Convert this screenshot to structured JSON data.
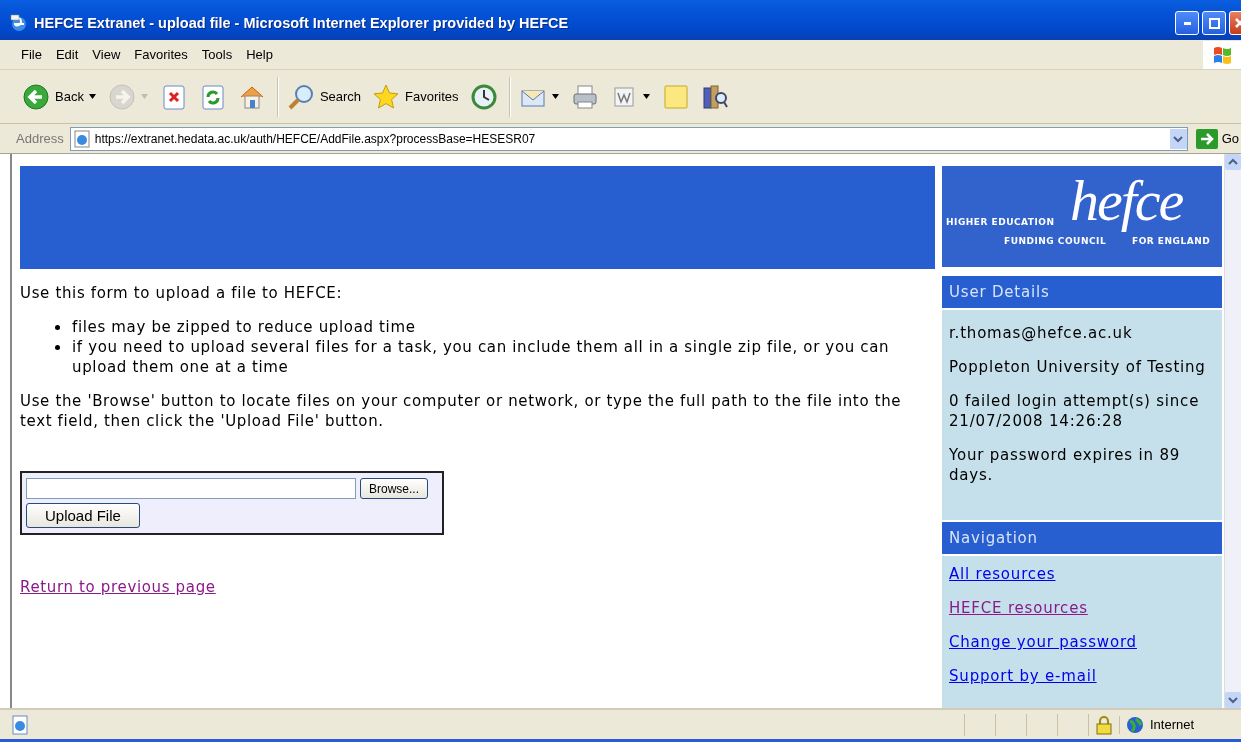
{
  "window": {
    "title": "HEFCE Extranet - upload file - Microsoft Internet Explorer provided by HEFCE"
  },
  "menu": [
    "File",
    "Edit",
    "View",
    "Favorites",
    "Tools",
    "Help"
  ],
  "toolbar": [
    {
      "kind": "back",
      "label": "Back",
      "disabled": false
    },
    {
      "kind": "forward",
      "disabled": true
    },
    {
      "kind": "stop",
      "disabled": false
    },
    {
      "kind": "refresh",
      "disabled": false
    },
    {
      "kind": "home",
      "disabled": false
    },
    {
      "kind": "search",
      "label": "Search",
      "disabled": false
    },
    {
      "kind": "favorites",
      "label": "Favorites",
      "disabled": false
    },
    {
      "kind": "history",
      "disabled": false
    },
    {
      "kind": "mail",
      "disabled": false
    },
    {
      "kind": "print",
      "disabled": false
    },
    {
      "kind": "word",
      "disabled": false
    },
    {
      "kind": "note",
      "disabled": false
    },
    {
      "kind": "research",
      "disabled": false
    }
  ],
  "address": {
    "label": "Address",
    "url": "https://extranet.hedata.ac.uk/auth/HEFCE/AddFile.aspx?processBase=HESESR07",
    "go": "Go"
  },
  "logo": {
    "wordmark": "hefce",
    "line_1": "HIGHER EDUCATION",
    "line_2": "FUNDING COUNCIL",
    "line_3": "FOR ENGLAND"
  },
  "main": {
    "intro": "Use this form to upload a file to HEFCE:",
    "bullets": [
      "files may be zipped to reduce upload time",
      "if you need to upload several files for a task, you can include them all in a single zip file, or you can upload them one at a time"
    ],
    "instructions": "Use the 'Browse' button to locate files on your computer or network, or type the full path to the file into the text field, then click the 'Upload File' button.",
    "upload": {
      "browse": "Browse...",
      "submit": "Upload File"
    },
    "back_link": {
      "label": "Return to previous page",
      "visited": true
    }
  },
  "sidebar": {
    "user_details": {
      "heading": "User Details",
      "lines": [
        "r.thomas@hefce.ac.uk",
        "Poppleton University of Testing",
        "0 failed login attempt(s) since 21/07/2008 14:26:28",
        "Your password expires in 89 days."
      ]
    },
    "navigation": {
      "heading": "Navigation",
      "links": [
        {
          "label": "All resources",
          "visited": false
        },
        {
          "label": "HEFCE resources",
          "visited": true
        },
        {
          "label": "Change your password",
          "visited": false
        },
        {
          "label": "Support by e-mail",
          "visited": false
        }
      ]
    }
  },
  "status_bar": {
    "zone": "Internet"
  }
}
